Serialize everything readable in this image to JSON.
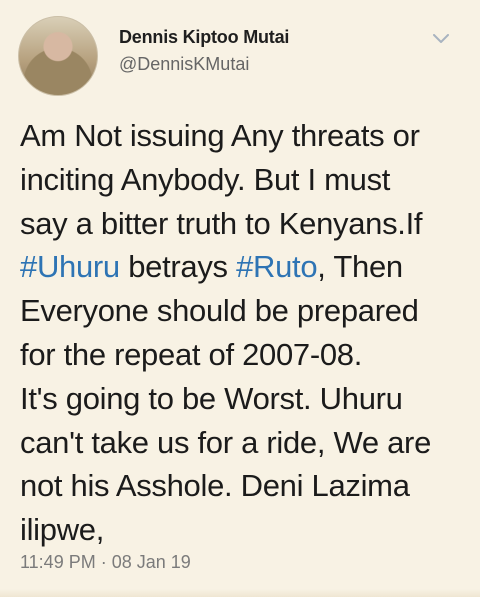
{
  "profile": {
    "name": "Dennis Kiptoo Mutai",
    "handle": "@DennisKMutai"
  },
  "tweet": {
    "line1": "Am Not issuing Any threats or",
    "line2": "inciting Anybody. But I must",
    "line3": "say a bitter truth to Kenyans.If",
    "line4_hashtag1": "#Uhuru",
    "line4_middle": " betrays ",
    "line4_hashtag2": "#Ruto",
    "line4_end": ", Then",
    "line5": "Everyone should be prepared",
    "line6": "for the repeat of 2007-08.",
    "line7": "It's going to be Worst. Uhuru",
    "line8": "can't take us for a ride, We are",
    "line9": "not his Asshole. Deni Lazima",
    "line10": "ilipwe,"
  },
  "meta": {
    "timestamp": "11:49 PM · 08 Jan 19"
  },
  "icons": {
    "more": "chevron-down-icon"
  },
  "colors": {
    "background": "#f8f2e4",
    "hashtag": "#2e74b4"
  }
}
